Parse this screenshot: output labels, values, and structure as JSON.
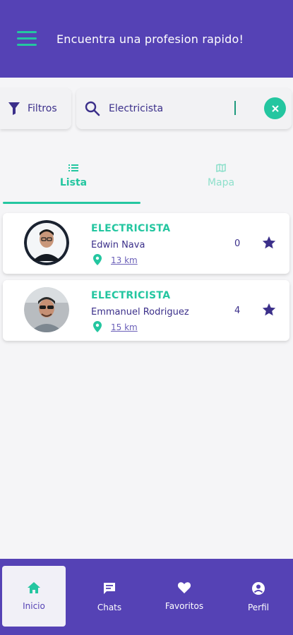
{
  "header": {
    "title": "Encuentra una profesion rapido!",
    "menu_icon": "hamburger-menu-icon"
  },
  "filters": {
    "label": "Filtros",
    "icon": "funnel-icon"
  },
  "search": {
    "value": "Electricista",
    "placeholder": "",
    "clear_icon": "close-icon"
  },
  "tabs": [
    {
      "label": "Lista",
      "icon": "list-icon",
      "active": true
    },
    {
      "label": "Mapa",
      "icon": "map-icon",
      "active": false
    }
  ],
  "results": [
    {
      "profession": "ELECTRICISTA",
      "name": "Edwin Nava",
      "distance": "13 km",
      "rating": "0"
    },
    {
      "profession": "ELECTRICISTA",
      "name": "Emmanuel Rodriguez",
      "distance": "15 km",
      "rating": "4"
    }
  ],
  "bottom_nav": [
    {
      "label": "Inicio",
      "icon": "home-icon",
      "active": true
    },
    {
      "label": "Chats",
      "icon": "chat-icon",
      "active": false
    },
    {
      "label": "Favoritos",
      "icon": "heart-icon",
      "active": false
    },
    {
      "label": "Perfil",
      "icon": "account-circle-icon",
      "active": false
    }
  ],
  "colors": {
    "primary": "#5542b5",
    "accent": "#24c6a0",
    "text_dark": "#3b2f8a",
    "star": "#3b2f8a"
  }
}
